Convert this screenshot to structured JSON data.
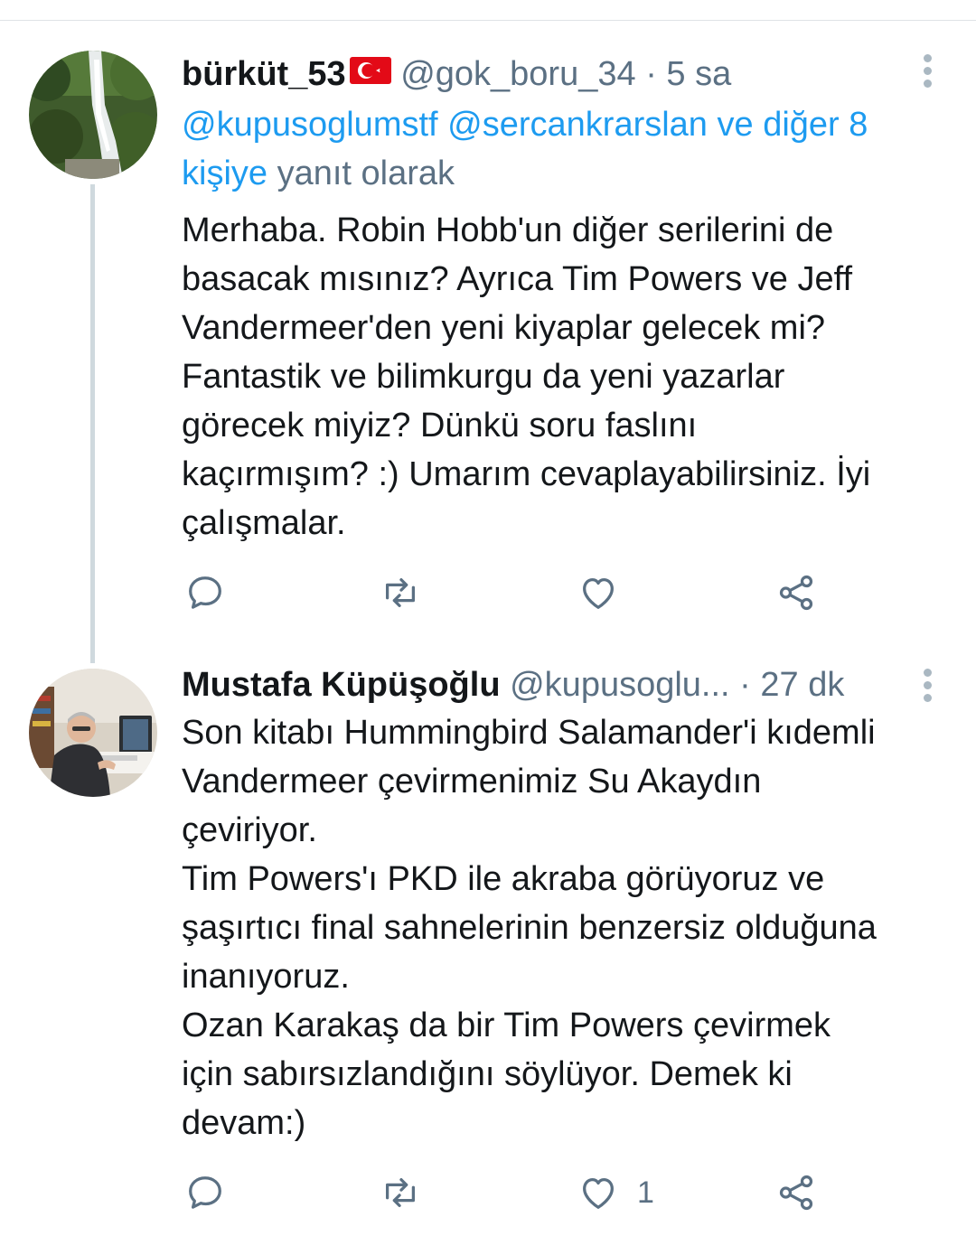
{
  "tweet1": {
    "display_name": "bürküt_53",
    "handle": "@gok_boru_34",
    "time": "· 5 sa",
    "reply_mention_1": "@kupusoglumstf",
    "reply_mention_2": "@sercankrarslan",
    "reply_others": "ve diğer 8",
    "reply_others_2": "kişiye",
    "reply_suffix": "yanıt olarak",
    "lines": [
      "Merhaba. Robin Hobb'un diğer serilerini de",
      "basacak mısınız? Ayrıca Tim Powers ve Jeff",
      "Vandermeer'den yeni kiyaplar gelecek mi?",
      "Fantastik ve bilimkurgu da yeni yazarlar",
      "görecek miyiz? Dünkü soru faslını",
      "kaçırmışım? :) Umarım cevaplayabilirsiniz. İyi",
      "çalışmalar."
    ],
    "like_count": ""
  },
  "tweet2": {
    "display_name": "Mustafa Küpüşoğlu",
    "handle": "@kupusoglu...",
    "time": "· 27 dk",
    "lines": [
      "Son kitabı Hummingbird Salamander'i kıdemli",
      "Vandermeer çevirmenimiz Su Akaydın",
      "çeviriyor.",
      "Tim Powers'ı PKD ile akraba görüyoruz ve",
      "şaşırtıcı final sahnelerinin benzersiz olduğuna",
      "inanıyoruz.",
      "Ozan Karakaş da bir Tim Powers çevirmek",
      "için sabırsızlandığını söylüyor. Demek ki",
      "devam:)"
    ],
    "like_count": "1"
  },
  "icons": [
    "reply-icon",
    "retweet-icon",
    "like-icon",
    "share-icon",
    "more-options-icon",
    "turkey-flag-icon"
  ],
  "colors": {
    "link": "#1d9bf0",
    "secondary_text": "#5b7083",
    "icon": "#5b7083",
    "thread_line": "#cfd9de"
  }
}
